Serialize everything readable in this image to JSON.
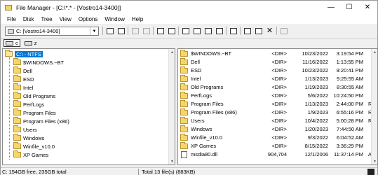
{
  "window": {
    "title": "File Manager - [C:\\*.* - [Vostro14-3400]]",
    "minimize_glyph": "—",
    "maximize_glyph": "☐",
    "close_glyph": "✕"
  },
  "menu": {
    "items": [
      "File",
      "Disk",
      "Tree",
      "View",
      "Options",
      "Window",
      "Help"
    ]
  },
  "toolbar": {
    "drive_selector": "C: [Vostro14-3400]",
    "buttons": [
      "connect-network-drive",
      "disconnect-network-drive",
      "share-folder",
      "stop-sharing",
      "view-name",
      "view-all-details",
      "view-partial-details",
      "sort-by-name",
      "sort-by-type",
      "sort-by-size",
      "sort-by-date",
      "new-window",
      "copy",
      "paste",
      "delete",
      "properties"
    ]
  },
  "drivebar": {
    "drives": [
      {
        "label": "c",
        "selected": true
      },
      {
        "label": "z",
        "selected": false
      }
    ]
  },
  "tree": {
    "root": "C:\\ - NTFS",
    "folders": [
      "$WINDOWS.~BT",
      "Dell",
      "ESD",
      "Intel",
      "Old Programs",
      "PerfLogs",
      "Program Files",
      "Program Files (x86)",
      "Users",
      "Windows",
      "Winfile_v10.0",
      "XP Games"
    ]
  },
  "files": {
    "rows": [
      {
        "name": "$WINDOWS.~BT",
        "size": "<DIR>",
        "date": "10/23/2022",
        "time": "3:19:54 PM",
        "attr": "",
        "type": "folder"
      },
      {
        "name": "Dell",
        "size": "<DIR>",
        "date": "11/16/2022",
        "time": "1:13:55 PM",
        "attr": "",
        "type": "folder"
      },
      {
        "name": "ESD",
        "size": "<DIR>",
        "date": "10/23/2022",
        "time": "9:20:41 PM",
        "attr": "",
        "type": "folder"
      },
      {
        "name": "Intel",
        "size": "<DIR>",
        "date": "1/13/2023",
        "time": "9:25:55 AM",
        "attr": "",
        "type": "folder"
      },
      {
        "name": "Old Programs",
        "size": "<DIR>",
        "date": "1/19/2023",
        "time": "8:30:55 AM",
        "attr": "",
        "type": "folder"
      },
      {
        "name": "PerfLogs",
        "size": "<DIR>",
        "date": "5/6/2022",
        "time": "10:24:50 PM",
        "attr": "",
        "type": "folder"
      },
      {
        "name": "Program Files",
        "size": "<DIR>",
        "date": "1/13/2023",
        "time": "2:44:00 PM",
        "attr": "R",
        "type": "folder"
      },
      {
        "name": "Program Files (x86)",
        "size": "<DIR>",
        "date": "1/9/2023",
        "time": "6:55:16 PM",
        "attr": "R",
        "type": "folder"
      },
      {
        "name": "Users",
        "size": "<DIR>",
        "date": "10/4/2022",
        "time": "5:00:28 PM",
        "attr": "R",
        "type": "folder"
      },
      {
        "name": "Windows",
        "size": "<DIR>",
        "date": "1/20/2023",
        "time": "7:44:50 AM",
        "attr": "",
        "type": "folder"
      },
      {
        "name": "Winfile_v10.0",
        "size": "<DIR>",
        "date": "9/3/2022",
        "time": "6:04:52 AM",
        "attr": "",
        "type": "folder"
      },
      {
        "name": "XP Games",
        "size": "<DIR>",
        "date": "8/15/2022",
        "time": "3:36:29 PM",
        "attr": "",
        "type": "folder"
      },
      {
        "name": "msdia80.dll",
        "size": "904,704",
        "date": "12/1/2006",
        "time": "11:37:14 PM",
        "attr": "A",
        "type": "file"
      }
    ]
  },
  "status": {
    "left": "C: 154GB free,  235GB total",
    "right": "Total 13 file(s) (883KB)"
  },
  "colors": {
    "selection": "#0078d7",
    "folder": "#f6d66a"
  }
}
